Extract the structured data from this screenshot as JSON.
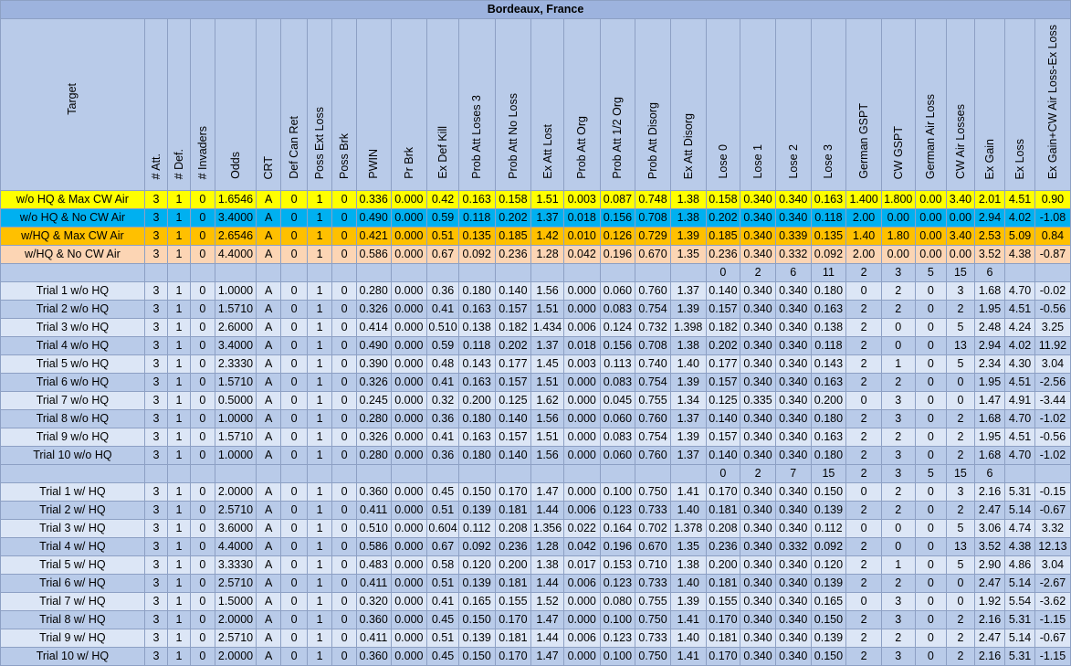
{
  "sheet": {
    "title": "Bordeaux, France",
    "headers": [
      "Target",
      "# Att.",
      "# Def.",
      "# Invaders",
      "Odds",
      "CRT",
      "Def Can Ret",
      "Poss Ext Loss",
      "Poss Brk",
      "PWIN",
      "Pr Brk",
      "Ex Def Kill",
      "Prob Att Loses 3",
      "Prob Att No Loss",
      "Ex Att Lost",
      "Prob Att Org",
      "Prob Att 1/2 Org",
      "Prob Att Disorg",
      "Ex Att Disorg",
      "Lose 0",
      "Lose 1",
      "Lose 2",
      "Lose 3",
      "German GSPT",
      "CW GSPT",
      "German Air Loss",
      "CW Air Losses",
      "Ex Gain",
      "Ex Loss",
      "Ex Gain+CW Air Loss-Ex Loss"
    ],
    "scenarios": [
      [
        "w/o HQ & Max CW Air",
        "3",
        "1",
        "0",
        "1.6546",
        "A",
        "0",
        "1",
        "0",
        "0.336",
        "0.000",
        "0.42",
        "0.163",
        "0.158",
        "1.51",
        "0.003",
        "0.087",
        "0.748",
        "1.38",
        "0.158",
        "0.340",
        "0.340",
        "0.163",
        "1.400",
        "1.800",
        "0.00",
        "3.40",
        "2.01",
        "4.51",
        "0.90"
      ],
      [
        "w/o HQ & No CW Air",
        "3",
        "1",
        "0",
        "3.4000",
        "A",
        "0",
        "1",
        "0",
        "0.490",
        "0.000",
        "0.59",
        "0.118",
        "0.202",
        "1.37",
        "0.018",
        "0.156",
        "0.708",
        "1.38",
        "0.202",
        "0.340",
        "0.340",
        "0.118",
        "2.00",
        "0.00",
        "0.00",
        "0.00",
        "2.94",
        "4.02",
        "-1.08"
      ],
      [
        "w/HQ & Max CW Air",
        "3",
        "1",
        "0",
        "2.6546",
        "A",
        "0",
        "1",
        "0",
        "0.421",
        "0.000",
        "0.51",
        "0.135",
        "0.185",
        "1.42",
        "0.010",
        "0.126",
        "0.729",
        "1.39",
        "0.185",
        "0.340",
        "0.339",
        "0.135",
        "1.40",
        "1.80",
        "0.00",
        "3.40",
        "2.53",
        "5.09",
        "0.84"
      ],
      [
        "w/HQ & No CW Air",
        "3",
        "1",
        "0",
        "4.4000",
        "A",
        "0",
        "1",
        "0",
        "0.586",
        "0.000",
        "0.67",
        "0.092",
        "0.236",
        "1.28",
        "0.042",
        "0.196",
        "0.670",
        "1.35",
        "0.236",
        "0.340",
        "0.332",
        "0.092",
        "2.00",
        "0.00",
        "0.00",
        "0.00",
        "3.52",
        "4.38",
        "-0.87"
      ]
    ],
    "sep1": [
      "0",
      "2",
      "6",
      "11",
      "2",
      "3",
      "5",
      "15",
      "6"
    ],
    "trials_without_hq": [
      [
        "Trial 1 w/o HQ",
        "3",
        "1",
        "0",
        "1.0000",
        "A",
        "0",
        "1",
        "0",
        "0.280",
        "0.000",
        "0.36",
        "0.180",
        "0.140",
        "1.56",
        "0.000",
        "0.060",
        "0.760",
        "1.37",
        "0.140",
        "0.340",
        "0.340",
        "0.180",
        "0",
        "2",
        "0",
        "3",
        "1.68",
        "4.70",
        "-0.02"
      ],
      [
        "Trial 2 w/o HQ",
        "3",
        "1",
        "0",
        "1.5710",
        "A",
        "0",
        "1",
        "0",
        "0.326",
        "0.000",
        "0.41",
        "0.163",
        "0.157",
        "1.51",
        "0.000",
        "0.083",
        "0.754",
        "1.39",
        "0.157",
        "0.340",
        "0.340",
        "0.163",
        "2",
        "2",
        "0",
        "2",
        "1.95",
        "4.51",
        "-0.56"
      ],
      [
        "Trial 3 w/o HQ",
        "3",
        "1",
        "0",
        "2.6000",
        "A",
        "0",
        "1",
        "0",
        "0.414",
        "0.000",
        "0.510",
        "0.138",
        "0.182",
        "1.434",
        "0.006",
        "0.124",
        "0.732",
        "1.398",
        "0.182",
        "0.340",
        "0.340",
        "0.138",
        "2",
        "0",
        "0",
        "5",
        "2.48",
        "4.24",
        "3.25"
      ],
      [
        "Trial 4 w/o HQ",
        "3",
        "1",
        "0",
        "3.4000",
        "A",
        "0",
        "1",
        "0",
        "0.490",
        "0.000",
        "0.59",
        "0.118",
        "0.202",
        "1.37",
        "0.018",
        "0.156",
        "0.708",
        "1.38",
        "0.202",
        "0.340",
        "0.340",
        "0.118",
        "2",
        "0",
        "0",
        "13",
        "2.94",
        "4.02",
        "11.92"
      ],
      [
        "Trial 5 w/o HQ",
        "3",
        "1",
        "0",
        "2.3330",
        "A",
        "0",
        "1",
        "0",
        "0.390",
        "0.000",
        "0.48",
        "0.143",
        "0.177",
        "1.45",
        "0.003",
        "0.113",
        "0.740",
        "1.40",
        "0.177",
        "0.340",
        "0.340",
        "0.143",
        "2",
        "1",
        "0",
        "5",
        "2.34",
        "4.30",
        "3.04"
      ],
      [
        "Trial 6 w/o HQ",
        "3",
        "1",
        "0",
        "1.5710",
        "A",
        "0",
        "1",
        "0",
        "0.326",
        "0.000",
        "0.41",
        "0.163",
        "0.157",
        "1.51",
        "0.000",
        "0.083",
        "0.754",
        "1.39",
        "0.157",
        "0.340",
        "0.340",
        "0.163",
        "2",
        "2",
        "0",
        "0",
        "1.95",
        "4.51",
        "-2.56"
      ],
      [
        "Trial 7 w/o HQ",
        "3",
        "1",
        "0",
        "0.5000",
        "A",
        "0",
        "1",
        "0",
        "0.245",
        "0.000",
        "0.32",
        "0.200",
        "0.125",
        "1.62",
        "0.000",
        "0.045",
        "0.755",
        "1.34",
        "0.125",
        "0.335",
        "0.340",
        "0.200",
        "0",
        "3",
        "0",
        "0",
        "1.47",
        "4.91",
        "-3.44"
      ],
      [
        "Trial 8 w/o HQ",
        "3",
        "1",
        "0",
        "1.0000",
        "A",
        "0",
        "1",
        "0",
        "0.280",
        "0.000",
        "0.36",
        "0.180",
        "0.140",
        "1.56",
        "0.000",
        "0.060",
        "0.760",
        "1.37",
        "0.140",
        "0.340",
        "0.340",
        "0.180",
        "2",
        "3",
        "0",
        "2",
        "1.68",
        "4.70",
        "-1.02"
      ],
      [
        "Trial 9 w/o HQ",
        "3",
        "1",
        "0",
        "1.5710",
        "A",
        "0",
        "1",
        "0",
        "0.326",
        "0.000",
        "0.41",
        "0.163",
        "0.157",
        "1.51",
        "0.000",
        "0.083",
        "0.754",
        "1.39",
        "0.157",
        "0.340",
        "0.340",
        "0.163",
        "2",
        "2",
        "0",
        "2",
        "1.95",
        "4.51",
        "-0.56"
      ],
      [
        "Trial 10 w/o HQ",
        "3",
        "1",
        "0",
        "1.0000",
        "A",
        "0",
        "1",
        "0",
        "0.280",
        "0.000",
        "0.36",
        "0.180",
        "0.140",
        "1.56",
        "0.000",
        "0.060",
        "0.760",
        "1.37",
        "0.140",
        "0.340",
        "0.340",
        "0.180",
        "2",
        "3",
        "0",
        "2",
        "1.68",
        "4.70",
        "-1.02"
      ]
    ],
    "sep2": [
      "0",
      "2",
      "7",
      "15",
      "2",
      "3",
      "5",
      "15",
      "6"
    ],
    "trials_with_hq": [
      [
        "Trial 1 w/ HQ",
        "3",
        "1",
        "0",
        "2.0000",
        "A",
        "0",
        "1",
        "0",
        "0.360",
        "0.000",
        "0.45",
        "0.150",
        "0.170",
        "1.47",
        "0.000",
        "0.100",
        "0.750",
        "1.41",
        "0.170",
        "0.340",
        "0.340",
        "0.150",
        "0",
        "2",
        "0",
        "3",
        "2.16",
        "5.31",
        "-0.15"
      ],
      [
        "Trial 2 w/ HQ",
        "3",
        "1",
        "0",
        "2.5710",
        "A",
        "0",
        "1",
        "0",
        "0.411",
        "0.000",
        "0.51",
        "0.139",
        "0.181",
        "1.44",
        "0.006",
        "0.123",
        "0.733",
        "1.40",
        "0.181",
        "0.340",
        "0.340",
        "0.139",
        "2",
        "2",
        "0",
        "2",
        "2.47",
        "5.14",
        "-0.67"
      ],
      [
        "Trial 3 w/ HQ",
        "3",
        "1",
        "0",
        "3.6000",
        "A",
        "0",
        "1",
        "0",
        "0.510",
        "0.000",
        "0.604",
        "0.112",
        "0.208",
        "1.356",
        "0.022",
        "0.164",
        "0.702",
        "1.378",
        "0.208",
        "0.340",
        "0.340",
        "0.112",
        "0",
        "0",
        "0",
        "5",
        "3.06",
        "4.74",
        "3.32"
      ],
      [
        "Trial 4 w/ HQ",
        "3",
        "1",
        "0",
        "4.4000",
        "A",
        "0",
        "1",
        "0",
        "0.586",
        "0.000",
        "0.67",
        "0.092",
        "0.236",
        "1.28",
        "0.042",
        "0.196",
        "0.670",
        "1.35",
        "0.236",
        "0.340",
        "0.332",
        "0.092",
        "2",
        "0",
        "0",
        "13",
        "3.52",
        "4.38",
        "12.13"
      ],
      [
        "Trial 5 w/ HQ",
        "3",
        "1",
        "0",
        "3.3330",
        "A",
        "0",
        "1",
        "0",
        "0.483",
        "0.000",
        "0.58",
        "0.120",
        "0.200",
        "1.38",
        "0.017",
        "0.153",
        "0.710",
        "1.38",
        "0.200",
        "0.340",
        "0.340",
        "0.120",
        "2",
        "1",
        "0",
        "5",
        "2.90",
        "4.86",
        "3.04"
      ],
      [
        "Trial 6 w/ HQ",
        "3",
        "1",
        "0",
        "2.5710",
        "A",
        "0",
        "1",
        "0",
        "0.411",
        "0.000",
        "0.51",
        "0.139",
        "0.181",
        "1.44",
        "0.006",
        "0.123",
        "0.733",
        "1.40",
        "0.181",
        "0.340",
        "0.340",
        "0.139",
        "2",
        "2",
        "0",
        "0",
        "2.47",
        "5.14",
        "-2.67"
      ],
      [
        "Trial 7 w/ HQ",
        "3",
        "1",
        "0",
        "1.5000",
        "A",
        "0",
        "1",
        "0",
        "0.320",
        "0.000",
        "0.41",
        "0.165",
        "0.155",
        "1.52",
        "0.000",
        "0.080",
        "0.755",
        "1.39",
        "0.155",
        "0.340",
        "0.340",
        "0.165",
        "0",
        "3",
        "0",
        "0",
        "1.92",
        "5.54",
        "-3.62"
      ],
      [
        "Trial 8 w/ HQ",
        "3",
        "1",
        "0",
        "2.0000",
        "A",
        "0",
        "1",
        "0",
        "0.360",
        "0.000",
        "0.45",
        "0.150",
        "0.170",
        "1.47",
        "0.000",
        "0.100",
        "0.750",
        "1.41",
        "0.170",
        "0.340",
        "0.340",
        "0.150",
        "2",
        "3",
        "0",
        "2",
        "2.16",
        "5.31",
        "-1.15"
      ],
      [
        "Trial 9 w/ HQ",
        "3",
        "1",
        "0",
        "2.5710",
        "A",
        "0",
        "1",
        "0",
        "0.411",
        "0.000",
        "0.51",
        "0.139",
        "0.181",
        "1.44",
        "0.006",
        "0.123",
        "0.733",
        "1.40",
        "0.181",
        "0.340",
        "0.340",
        "0.139",
        "2",
        "2",
        "0",
        "2",
        "2.47",
        "5.14",
        "-0.67"
      ],
      [
        "Trial 10 w/ HQ",
        "3",
        "1",
        "0",
        "2.0000",
        "A",
        "0",
        "1",
        "0",
        "0.360",
        "0.000",
        "0.45",
        "0.150",
        "0.170",
        "1.47",
        "0.000",
        "0.100",
        "0.750",
        "1.41",
        "0.170",
        "0.340",
        "0.340",
        "0.150",
        "2",
        "3",
        "0",
        "2",
        "2.16",
        "5.31",
        "-1.15"
      ]
    ]
  }
}
